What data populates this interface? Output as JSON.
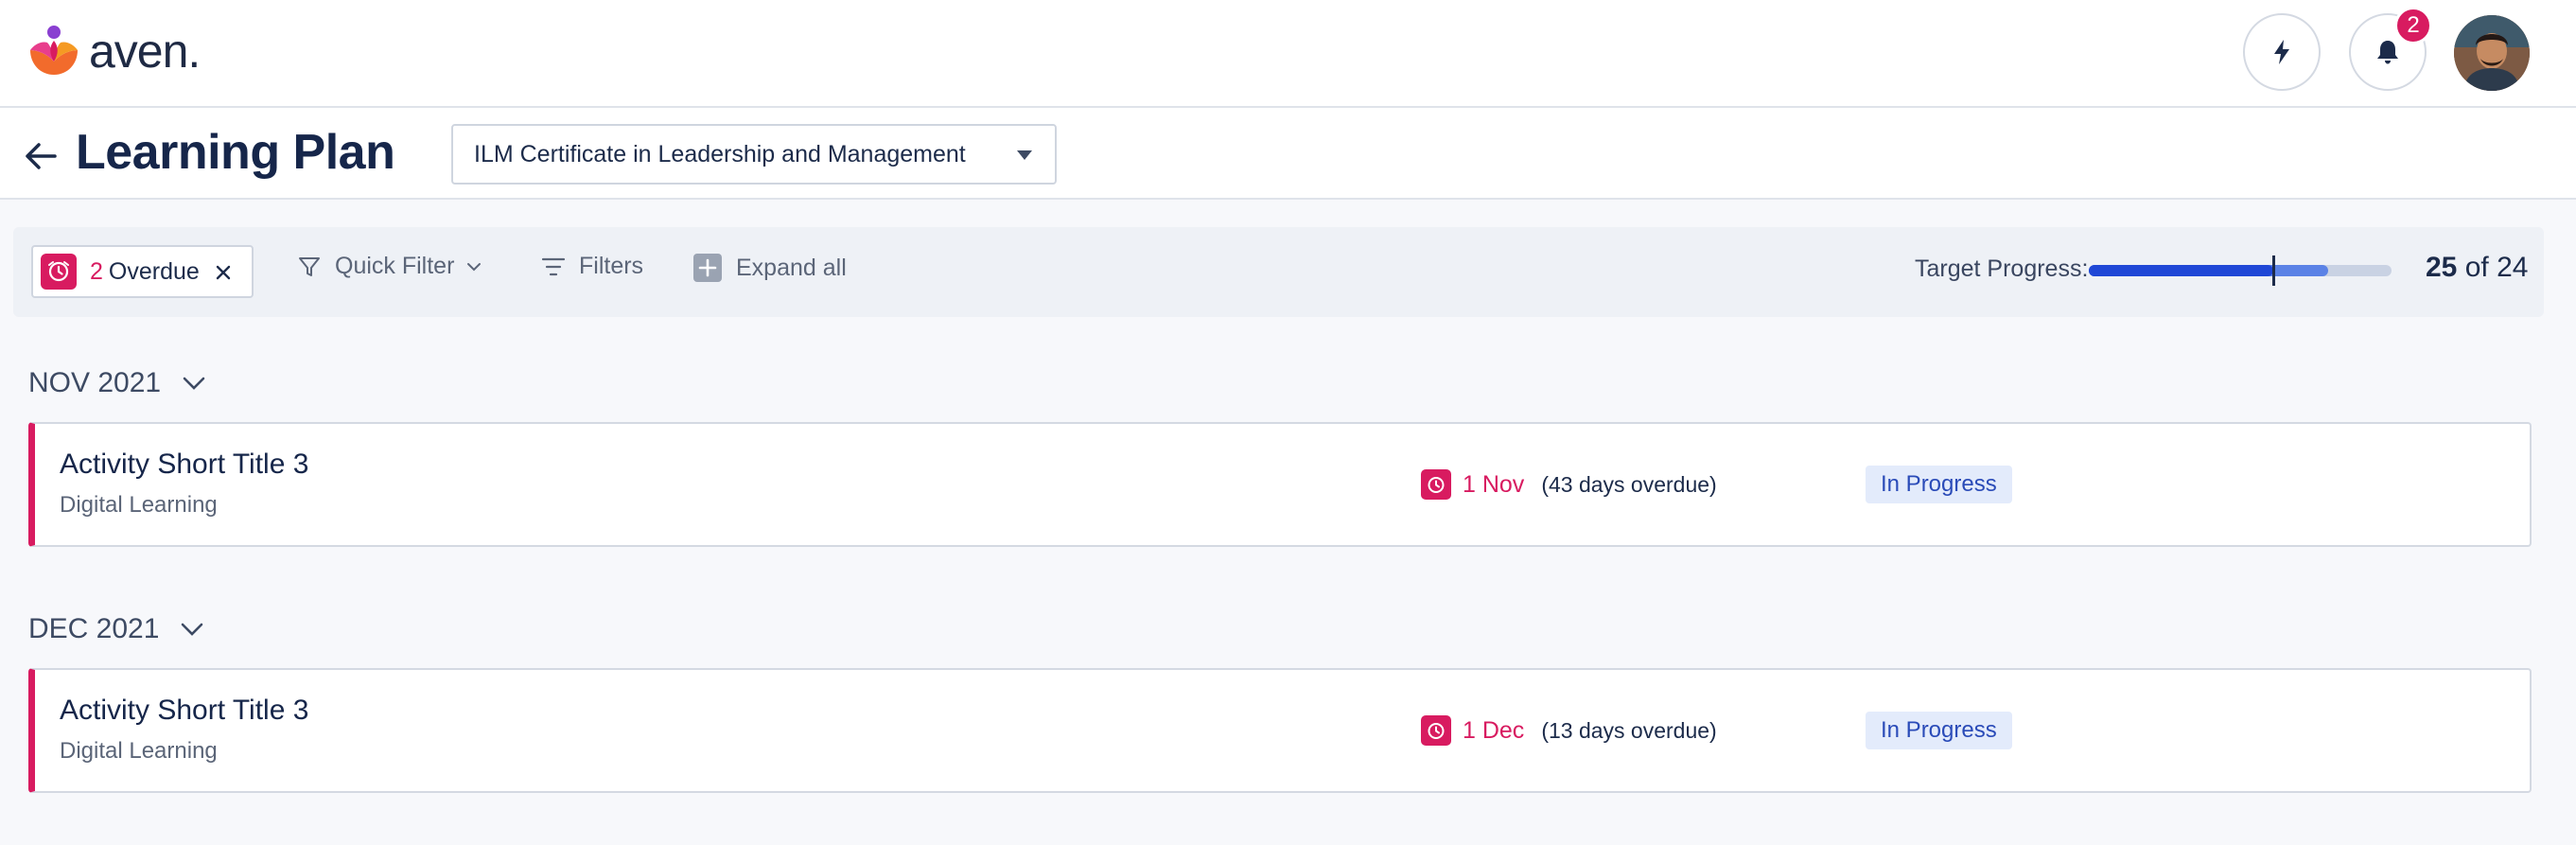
{
  "brand": {
    "name": "aven."
  },
  "header": {
    "notification_count": "2"
  },
  "page": {
    "title": "Learning Plan",
    "plan_select": {
      "value": "ILM Certificate in Leadership and Management"
    }
  },
  "filterbar": {
    "overdue": {
      "count": "2",
      "label": "Overdue"
    },
    "quick_filter_label": "Quick Filter",
    "filters_label": "Filters",
    "expand_all_label": "Expand all",
    "target_progress": {
      "label": "Target Progress:",
      "current": "25",
      "of_word": "of",
      "total": "24",
      "fill_fraction": 0.79,
      "marker_fraction": 0.61
    }
  },
  "groups": [
    {
      "title": "NOV 2021",
      "items": [
        {
          "title": "Activity Short Title 3",
          "type": "Digital Learning",
          "due_date": "1 Nov",
          "overdue_text": "(43 days overdue)",
          "status": "In Progress"
        }
      ]
    },
    {
      "title": "DEC 2021",
      "items": [
        {
          "title": "Activity Short Title 3",
          "type": "Digital Learning",
          "due_date": "1 Dec",
          "overdue_text": "(13 days overdue)",
          "status": "In Progress"
        }
      ]
    }
  ],
  "colors": {
    "accent": "#d81b60",
    "progress": "#1f47d6",
    "status_bg": "#e3ebfb",
    "status_text": "#2a4bb8"
  },
  "icons": {
    "quick_action": "lightning-icon",
    "notifications": "bell-icon",
    "back": "arrow-left-icon",
    "overdue": "clock-icon",
    "quick_filter": "funnel-icon",
    "filters": "filter-lines-icon",
    "expand_all": "plus-square-icon"
  }
}
